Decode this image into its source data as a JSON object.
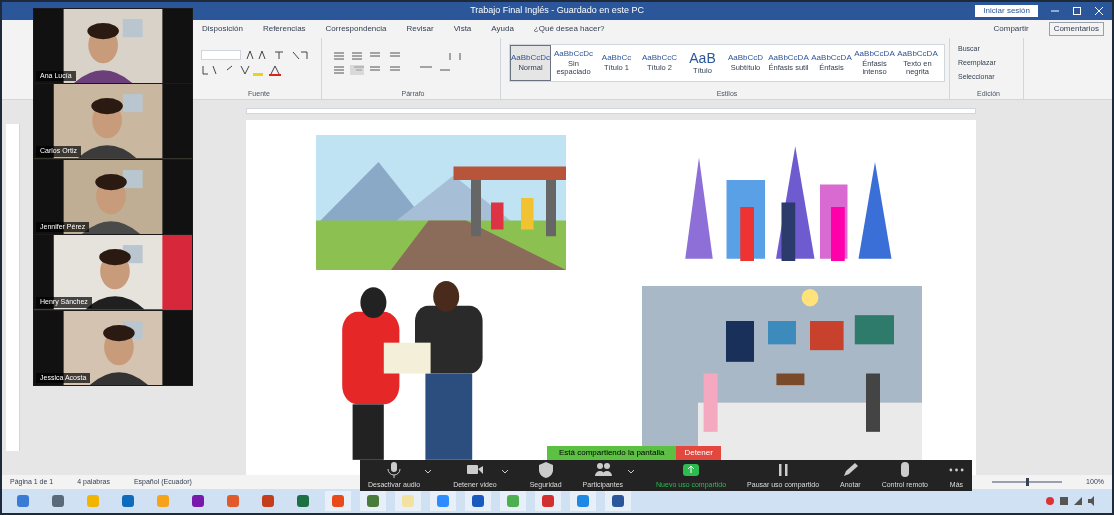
{
  "word": {
    "title": "Trabajo Final Inglés - Guardado en este PC",
    "signin": "Iniciar sesión",
    "tabs": [
      {
        "label": "Disposición",
        "selected": false
      },
      {
        "label": "Referencias",
        "selected": false
      },
      {
        "label": "Correspondencia",
        "selected": false
      },
      {
        "label": "Revisar",
        "selected": false
      },
      {
        "label": "Vista",
        "selected": false
      },
      {
        "label": "Ayuda",
        "selected": false
      },
      {
        "label": "¿Qué desea hacer?",
        "selected": false
      }
    ],
    "share": "Compartir",
    "comments": "Comentarios",
    "styles": [
      {
        "preview": "AaBbCcDc",
        "name": "Normal",
        "selected": true
      },
      {
        "preview": "AaBbCcDc",
        "name": "Sin espaciado",
        "selected": false
      },
      {
        "preview": "AaBbCc",
        "name": "Título 1",
        "selected": false
      },
      {
        "preview": "AaBbCcC",
        "name": "Título 2",
        "selected": false
      },
      {
        "preview": "AaB",
        "name": "Título",
        "selected": false
      },
      {
        "preview": "AaBbCcD",
        "name": "Subtítulo",
        "selected": false
      },
      {
        "preview": "AaBbCcDA",
        "name": "Énfasis sutil",
        "selected": false
      },
      {
        "preview": "AaBbCcDA",
        "name": "Énfasis",
        "selected": false
      },
      {
        "preview": "AaBbCcDA",
        "name": "Énfasis intenso",
        "selected": false
      },
      {
        "preview": "AaBbCcDA",
        "name": "Texto en negrita",
        "selected": false
      }
    ],
    "groups": [
      "Fuente",
      "Párrafo",
      "Estilos",
      "Edición"
    ],
    "editing": [
      "Buscar",
      "Reemplazar",
      "Seleccionar"
    ],
    "status": [
      "Página 1 de 1",
      "4 palabras",
      "Español (Ecuador)"
    ],
    "zoom_slider": {
      "level": 0.5
    },
    "zoom_level": "100%"
  },
  "video_tiles": [
    {
      "name": "Ana Lucía"
    },
    {
      "name": "Carlos Ortiz"
    },
    {
      "name": "Jennifer Pérez"
    },
    {
      "name": "Henry Sánchez"
    },
    {
      "name": "Jessica Acosta"
    }
  ],
  "sharing_banner": {
    "text": "Está compartiendo la pantalla",
    "stop": "Detener"
  },
  "zoom_toolbar": [
    {
      "label": "Desactivar audio",
      "caret": true,
      "highlight": false
    },
    {
      "label": "Detener video",
      "caret": true,
      "highlight": false
    },
    {
      "label": "Seguridad",
      "caret": false,
      "highlight": false
    },
    {
      "label": "Participantes",
      "caret": true,
      "highlight": false
    },
    {
      "label": "Nuevo uso compartido",
      "caret": false,
      "highlight": true
    },
    {
      "label": "Pausar uso compartido",
      "caret": false,
      "highlight": false
    },
    {
      "label": "Anotar",
      "caret": false,
      "highlight": false
    },
    {
      "label": "Control remoto",
      "caret": false,
      "highlight": false
    },
    {
      "label": "Más",
      "caret": false,
      "highlight": false
    }
  ]
}
